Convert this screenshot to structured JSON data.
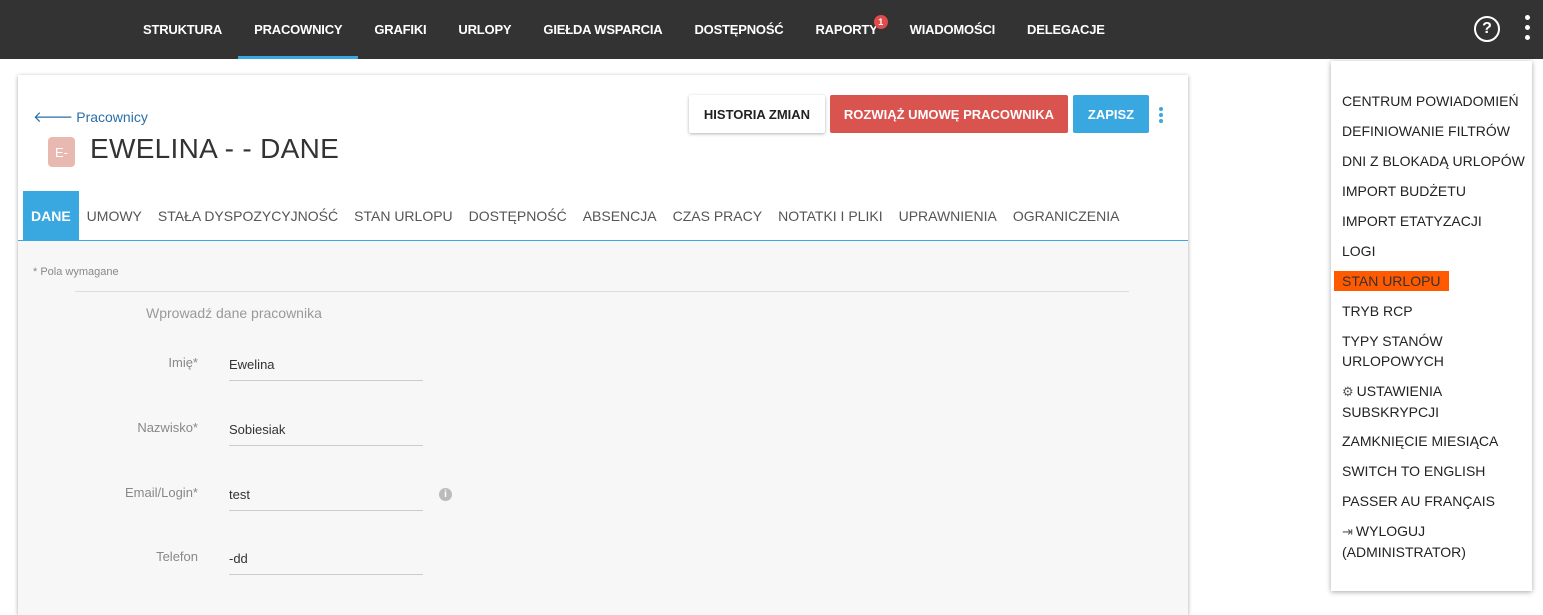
{
  "nav": {
    "items": [
      {
        "label": "STRUKTURA"
      },
      {
        "label": "PRACOWNICY",
        "active": true
      },
      {
        "label": "GRAFIKI"
      },
      {
        "label": "URLOPY"
      },
      {
        "label": "GIEŁDA WSPARCIA"
      },
      {
        "label": "DOSTĘPNOŚĆ"
      },
      {
        "label": "RAPORTY",
        "badge": "1"
      },
      {
        "label": "WIADOMOŚCI"
      },
      {
        "label": "DELEGACJE"
      }
    ],
    "help_label": "?"
  },
  "header": {
    "back_label": "Pracownicy",
    "avatar_initials": "E-",
    "title": "EWELINA - - DANE"
  },
  "actions": {
    "history": "HISTORIA ZMIAN",
    "terminate": "ROZWIĄŻ UMOWĘ PRACOWNIKA",
    "save": "ZAPISZ"
  },
  "tabs": [
    {
      "label": "DANE",
      "active": true
    },
    {
      "label": "UMOWY"
    },
    {
      "label": "STAŁA DYSPOZYCYJNOŚĆ"
    },
    {
      "label": "STAN URLOPU"
    },
    {
      "label": "DOSTĘPNOŚĆ"
    },
    {
      "label": "ABSENCJA"
    },
    {
      "label": "CZAS PRACY"
    },
    {
      "label": "NOTATKI I PLIKI"
    },
    {
      "label": "UPRAWNIENIA"
    },
    {
      "label": "OGRANICZENIA"
    }
  ],
  "form": {
    "required_note": "* Pola wymagane",
    "heading": "Wprowadź dane pracownika",
    "fields": [
      {
        "label": "Imię*",
        "value": "Ewelina"
      },
      {
        "label": "Nazwisko*",
        "value": "Sobiesiak"
      },
      {
        "label": "Email/Login*",
        "value": "test"
      },
      {
        "label": "Telefon",
        "value": "-dd"
      }
    ]
  },
  "menu": {
    "items": [
      {
        "label": "CENTRUM POWIADOMIEŃ"
      },
      {
        "label": "DEFINIOWANIE FILTRÓW"
      },
      {
        "label": "DNI Z BLOKADĄ URLOPÓW"
      },
      {
        "label": "IMPORT BUDŻETU"
      },
      {
        "label": "IMPORT ETATYZACJI"
      },
      {
        "label": "LOGI"
      },
      {
        "label": "STAN URLOPU",
        "highlighted": true
      },
      {
        "label": "TRYB RCP"
      },
      {
        "label": "TYPY STANÓW",
        "label2": "URLOPOWYCH"
      },
      {
        "label": "USTAWIENIA",
        "label2": "SUBSKRYPCJI",
        "icon": "gear-icon"
      },
      {
        "label": "ZAMKNIĘCIE MIESIĄCA"
      },
      {
        "label": "SWITCH TO ENGLISH"
      },
      {
        "label": "PASSER AU FRANÇAIS"
      },
      {
        "label": "WYLOGUJ",
        "label2": "(ADMINISTRATOR)",
        "icon": "logout-icon"
      }
    ]
  },
  "colors": {
    "topbar": "#333333",
    "accent": "#3aa8e0",
    "danger": "#d9534f",
    "highlight": "#ff5a00"
  }
}
